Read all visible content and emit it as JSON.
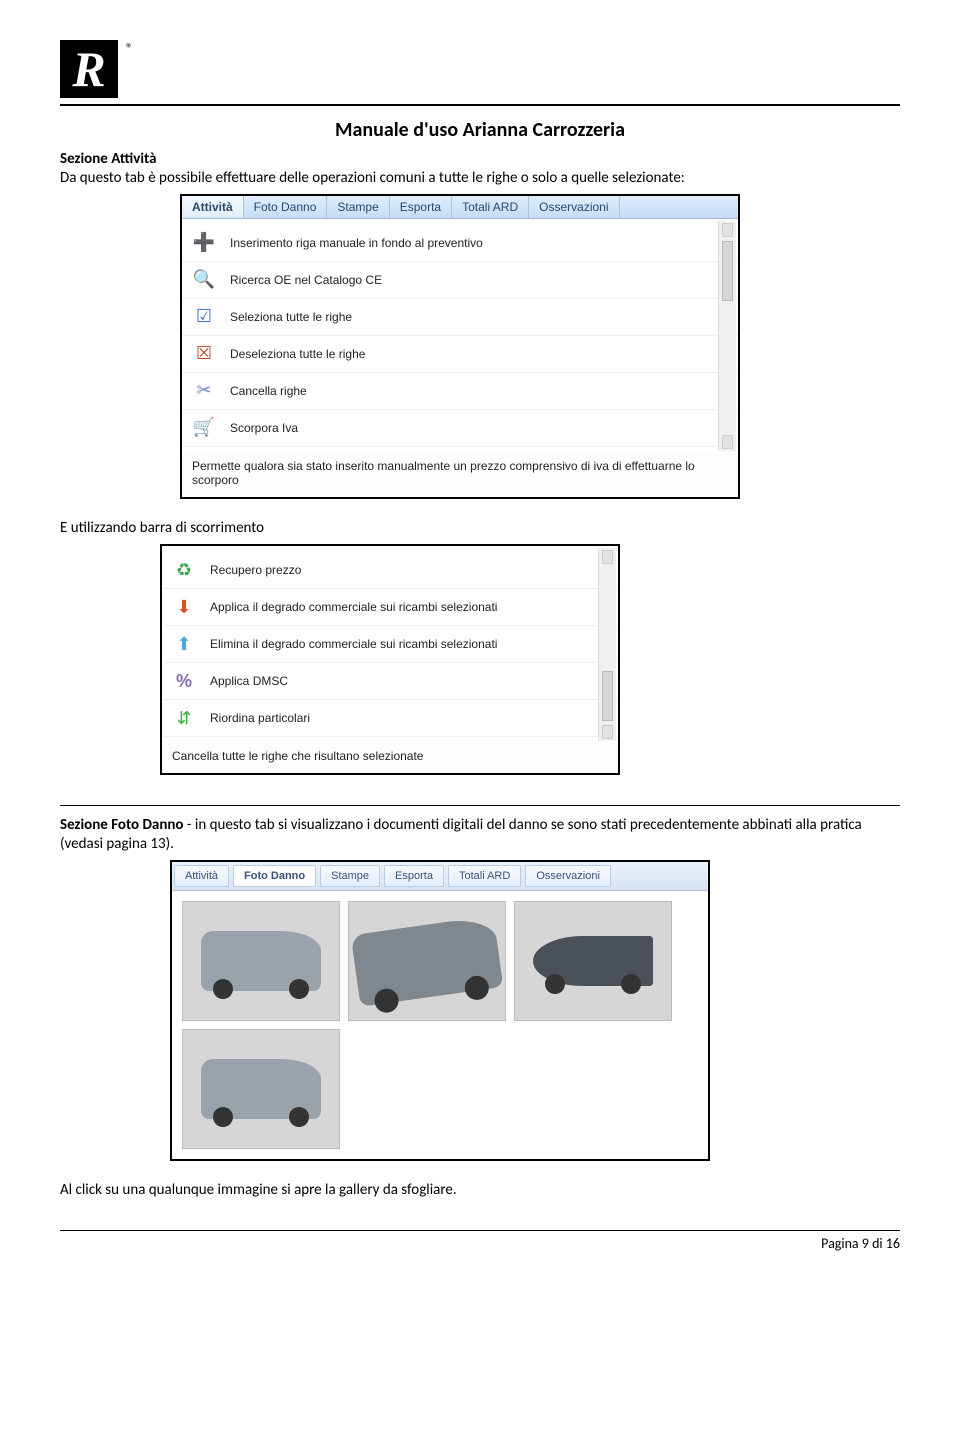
{
  "header": {
    "logo_letter": "R",
    "registered": "®",
    "doc_title": "Manuale d'uso Arianna Carrozzeria"
  },
  "sec1": {
    "heading": "Sezione Attività",
    "intro": "Da questo tab è possibile effettuare delle operazioni comuni a tutte le righe o solo a quelle selezionate:"
  },
  "ss1": {
    "tabs": [
      "Attività",
      "Foto Danno",
      "Stampe",
      "Esporta",
      "Totali ARD",
      "Osservazioni"
    ],
    "rows": [
      {
        "icon": "➕",
        "color": "#3fae3f",
        "label": "Inserimento riga manuale in fondo al preventivo"
      },
      {
        "icon": "🔍",
        "color": "#6fa248",
        "label": "Ricerca OE nel Catalogo CE"
      },
      {
        "icon": "☑",
        "color": "#3c73c7",
        "label": "Seleziona tutte le righe"
      },
      {
        "icon": "☒",
        "color": "#c24a2e",
        "label": "Deseleziona tutte le righe"
      },
      {
        "icon": "✂",
        "color": "#6b86c0",
        "label": "Cancella righe"
      },
      {
        "icon": "🛒",
        "color": "#9aa7c2",
        "label": "Scorpora Iva"
      }
    ],
    "footnote": "Permette qualora sia stato inserito manualmente un prezzo comprensivo di iva di effettuarne lo scorporo"
  },
  "mid": {
    "text": "E utilizzando barra di scorrimento"
  },
  "ss2": {
    "rows": [
      {
        "icon": "♻",
        "color": "#3fa94a",
        "label": "Recupero prezzo"
      },
      {
        "icon": "⬇",
        "color": "#d1572a",
        "label": "Applica il degrado commerciale sui ricambi selezionati"
      },
      {
        "icon": "⬆",
        "color": "#4ea9e0",
        "label": "Elimina il degrado commerciale sui ricambi selezionati"
      },
      {
        "icon": "%",
        "color": "#8a6fae",
        "label": "Applica DMSC"
      },
      {
        "icon": "⇵",
        "color": "#3fae3f",
        "label": "Riordina particolari"
      }
    ],
    "footnote": "Cancella tutte le righe che risultano selezionate"
  },
  "sec2": {
    "heading": "Sezione Foto Danno",
    "intro": " - in questo tab si visualizzano i documenti digitali del danno se sono stati precedentemente abbinati alla pratica (vedasi pagina 13)."
  },
  "ss3": {
    "tabs": [
      "Attività",
      "Foto Danno",
      "Stampe",
      "Esporta",
      "Totali ARD",
      "Osservazioni"
    ]
  },
  "closing": "Al click su una qualunque immagine si apre la gallery da sfogliare.",
  "footer": {
    "page_label": "Pagina 9 di 16"
  }
}
